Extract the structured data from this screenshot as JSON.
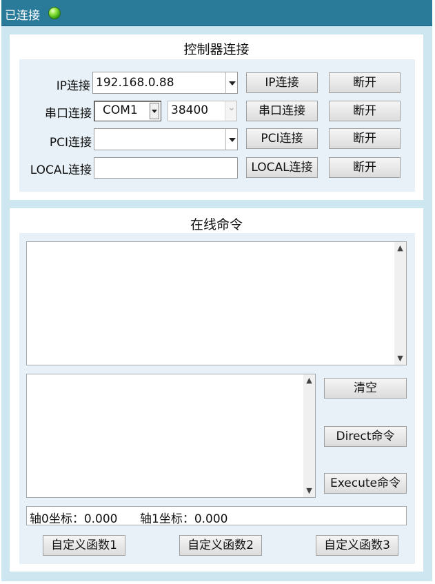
{
  "titlebar": {
    "status_text": "已连接",
    "led_color": "#3cc01a"
  },
  "connection": {
    "title": "控制器连接",
    "ip": {
      "label": "IP连接",
      "value": "192.168.0.88",
      "connect": "IP连接",
      "disconnect": "断开"
    },
    "serial": {
      "label": "串口连接",
      "port": "COM1",
      "baud": "38400",
      "connect": "串口连接",
      "disconnect": "断开"
    },
    "pci": {
      "label": "PCI连接",
      "value": "",
      "connect": "PCI连接",
      "disconnect": "断开"
    },
    "local": {
      "label": "LOCAL连接",
      "value": "",
      "connect": "LOCAL连接",
      "disconnect": "断开"
    }
  },
  "online": {
    "title": "在线命令",
    "clear": "清空",
    "direct": "Direct命令",
    "execute": "Execute命令",
    "axis0": "轴0坐标：0.000",
    "axis1": "轴1坐标：0.000",
    "func1": "自定义函数1",
    "func2": "自定义函数2",
    "func3": "自定义函数3"
  }
}
